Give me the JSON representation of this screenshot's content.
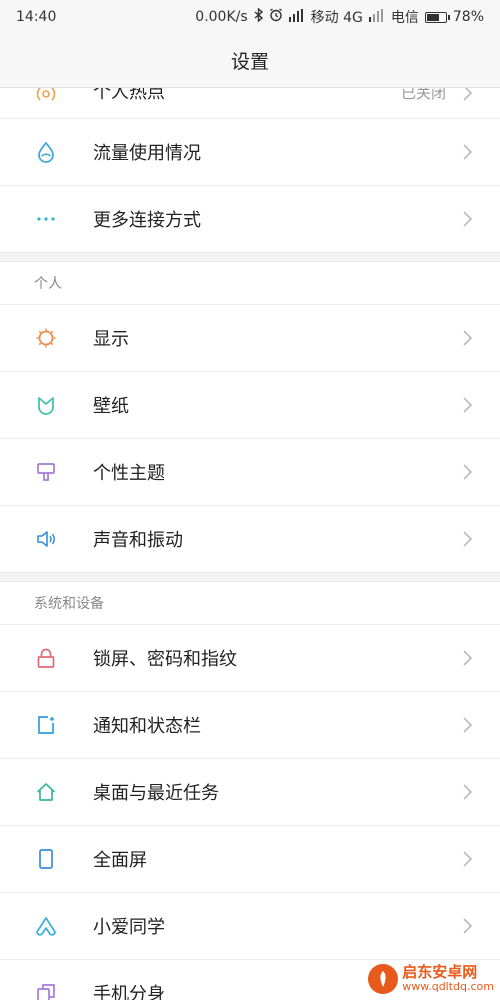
{
  "status_bar": {
    "time": "14:40",
    "speed": "0.00K/s",
    "carrier1": "移动 4G",
    "carrier2": "电信",
    "battery": "78%",
    "battery_level": 0.78
  },
  "title": "设置",
  "partial_row": {
    "label": "个人热点",
    "value": "已关闭"
  },
  "rows_top": [
    {
      "label": "流量使用情况"
    },
    {
      "label": "更多连接方式"
    }
  ],
  "section_personal": {
    "header": "个人",
    "rows": [
      {
        "label": "显示"
      },
      {
        "label": "壁纸"
      },
      {
        "label": "个性主题"
      },
      {
        "label": "声音和振动"
      }
    ]
  },
  "section_system": {
    "header": "系统和设备",
    "rows": [
      {
        "label": "锁屏、密码和指纹"
      },
      {
        "label": "通知和状态栏"
      },
      {
        "label": "桌面与最近任务"
      },
      {
        "label": "全面屏"
      },
      {
        "label": "小爱同学"
      },
      {
        "label": "手机分身"
      }
    ]
  },
  "watermark": {
    "title": "启东安卓网",
    "url": "www.qdltdq.com"
  },
  "colors": {
    "data_usage": "#3aa6d8",
    "more_connect": "#2fb0d9",
    "display": "#f08a4b",
    "wallpaper": "#3cc0a8",
    "theme": "#a77ad6",
    "sound": "#3a8fd8",
    "lock": "#e06a7a",
    "notification": "#2f9fe0",
    "home": "#38b89a",
    "fullscreen": "#3a8fd8",
    "xiaoai": "#3aaed8",
    "dual_app": "#a77ad6",
    "hotspot": "#f0a04b"
  }
}
